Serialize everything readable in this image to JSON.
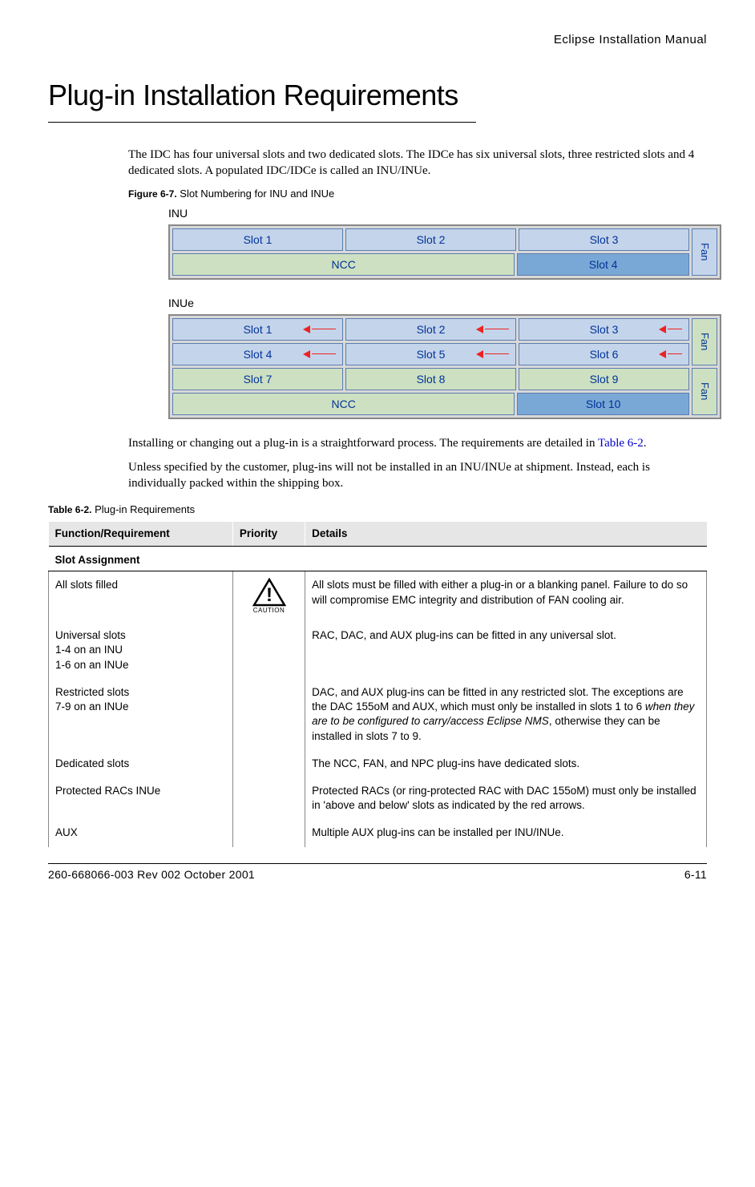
{
  "header": {
    "manual_title": "Eclipse Installation Manual"
  },
  "title": "Plug-in Installation Requirements",
  "intro": "The IDC has four universal slots and two dedicated slots. The IDCe has six universal slots, three restricted slots and 4 dedicated slots. A populated IDC/IDCe is called an INU/INUe.",
  "figure": {
    "label_bold": "Figure 6-7.",
    "label_text": " Slot Numbering for INU and INUe",
    "inu_label": "INU",
    "inue_label": "INUe",
    "slots": {
      "s1": "Slot 1",
      "s2": "Slot 2",
      "s3": "Slot 3",
      "s4": "Slot 4",
      "s5": "Slot 5",
      "s6": "Slot 6",
      "s7": "Slot 7",
      "s8": "Slot 8",
      "s9": "Slot 9",
      "s10": "Slot 10",
      "ncc": "NCC",
      "fan": "Fan"
    }
  },
  "para2_pre": "Installing or changing out a plug-in is a straightforward process. The requirements are detailed in ",
  "para2_link": "Table 6-2",
  "para2_post": ".",
  "para3": "Unless specified by the customer, plug-ins will not be installed in an INU/INUe at shipment. Instead, each is individually packed within the shipping box.",
  "table": {
    "caption_bold": "Table 6-2.",
    "caption_text": " Plug-in Requirements",
    "headers": {
      "c1": "Function/Requirement",
      "c2": "Priority",
      "c3": "Details"
    },
    "section1": "Slot Assignment",
    "rows": [
      {
        "func": "All slots filled",
        "priority_icon": true,
        "caution_label": "CAUTION",
        "details": "All slots must be filled with either a plug-in or a blanking panel. Failure to do so will compromise EMC integrity and distribution of FAN cooling air."
      },
      {
        "func": "Universal slots\n1-4 on an INU\n1-6 on an INUe",
        "details": "RAC, DAC, and AUX plug-ins can be fitted in any universal slot."
      },
      {
        "func": "Restricted slots\n7-9 on an INUe",
        "details_pre": "DAC, and AUX plug-ins can be fitted in any restricted slot. The exceptions are the DAC 155oM and AUX, which must only be installed in slots 1 to 6 ",
        "details_italic": "when they are to be configured to carry/access Eclipse NMS",
        "details_post": ", otherwise they can be installed in slots 7 to 9."
      },
      {
        "func": "Dedicated slots",
        "details": "The NCC, FAN, and NPC plug-ins have dedicated slots."
      },
      {
        "func": "Protected RACs INUe",
        "details": "Protected RACs (or ring-protected RAC with DAC 155oM) must only be installed in 'above and below' slots as indicated by the red arrows."
      },
      {
        "func": "AUX",
        "details": "Multiple AUX plug-ins can be installed per INU/INUe."
      }
    ]
  },
  "footer": {
    "left": "260-668066-003 Rev 002 October 2001",
    "right": "6-11"
  },
  "chart_data": {
    "type": "table",
    "title": "Slot Numbering for INU and INUe",
    "INU": {
      "rows": 2,
      "layout": [
        [
          "Slot 1",
          "Slot 2",
          "Slot 3",
          "Fan"
        ],
        [
          "NCC",
          "NCC",
          "Slot 4",
          "Fan"
        ]
      ],
      "universal_slots": [
        1,
        2,
        3,
        4
      ],
      "dedicated": [
        "NCC",
        "Fan"
      ]
    },
    "INUe": {
      "rows": 4,
      "layout": [
        [
          "Slot 1",
          "Slot 2",
          "Slot 3",
          "Fan"
        ],
        [
          "Slot 4",
          "Slot 5",
          "Slot 6",
          "Fan"
        ],
        [
          "Slot 7",
          "Slot 8",
          "Slot 9",
          "Fan"
        ],
        [
          "NCC",
          "NCC",
          "Slot 10",
          "Fan"
        ]
      ],
      "universal_slots": [
        1,
        2,
        3,
        4,
        5,
        6
      ],
      "restricted_slots": [
        7,
        8,
        9
      ],
      "dedicated": [
        "NCC",
        "Slot 10",
        "Fan",
        "Fan"
      ],
      "red_arrow_pairs": [
        [
          1,
          4
        ],
        [
          2,
          5
        ],
        [
          3,
          6
        ]
      ]
    }
  }
}
